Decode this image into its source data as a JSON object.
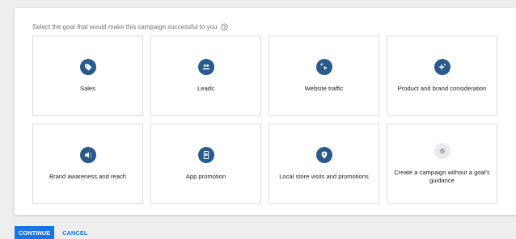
{
  "prompt": {
    "text": "Select the goal that would make this campaign successful to you",
    "help_icon": "help-circle-icon"
  },
  "goals": [
    {
      "label": "Sales",
      "icon": "tag-icon"
    },
    {
      "label": "Leads",
      "icon": "people-icon"
    },
    {
      "label": "Website traffic",
      "icon": "cursor-click-icon"
    },
    {
      "label": "Product and brand consideration",
      "icon": "sparkle-icon"
    },
    {
      "label": "Brand awareness and reach",
      "icon": "megaphone-icon"
    },
    {
      "label": "App promotion",
      "icon": "phone-icon"
    },
    {
      "label": "Local store visits and promotions",
      "icon": "location-pin-icon"
    },
    {
      "label": "Create a campaign without a goal's guidance",
      "icon": "gear-icon"
    }
  ],
  "actions": {
    "continue_label": "CONTINUE",
    "cancel_label": "CANCEL"
  },
  "colors": {
    "icon_badge": "#2a5a8a",
    "icon_badge_neutral": "#e8eaed",
    "primary": "#1a73e8"
  }
}
